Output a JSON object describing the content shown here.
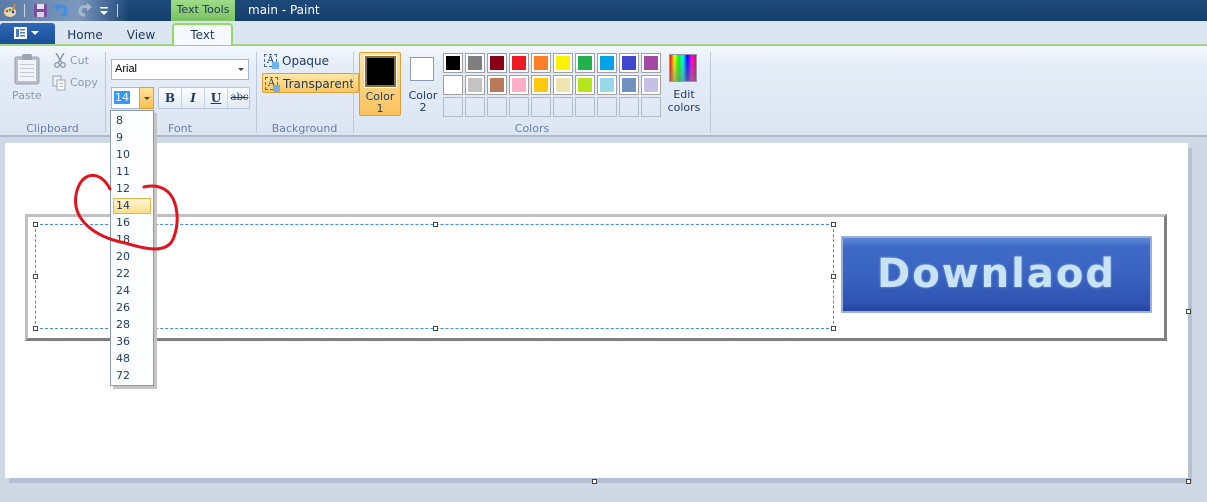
{
  "titlebar": {
    "context_tab": "Text Tools",
    "window_title": "main - Paint"
  },
  "tabs": [
    {
      "label": "Home",
      "active": false
    },
    {
      "label": "View",
      "active": false
    },
    {
      "label": "Text",
      "active": true
    }
  ],
  "ribbon": {
    "clipboard": {
      "group_label": "Clipboard",
      "paste_label": "Paste",
      "cut_label": "Cut",
      "copy_label": "Copy"
    },
    "font": {
      "group_label": "Font",
      "font_name": "Arial",
      "font_size": "14",
      "bold_label": "B",
      "italic_label": "I",
      "underline_label": "U",
      "strike_label": "abc"
    },
    "background": {
      "group_label": "Background",
      "opaque_label": "Opaque",
      "transparent_label": "Transparent",
      "selected": "Transparent"
    },
    "colors": {
      "group_label": "Colors",
      "color1_line1": "Color",
      "color1_line2": "1",
      "color2_line1": "Color",
      "color2_line2": "2",
      "color1_value": "#000000",
      "color2_value": "#ffffff",
      "edit_line1": "Edit",
      "edit_line2": "colors",
      "palette_row1": [
        "#000000",
        "#7f7f7f",
        "#880015",
        "#ed1c24",
        "#ff7f27",
        "#fff200",
        "#22b14c",
        "#00a2e8",
        "#3f48cc",
        "#a349a4"
      ],
      "palette_row2": [
        "#ffffff",
        "#c3c3c3",
        "#b97a57",
        "#ffaec9",
        "#ffc90e",
        "#efe4b0",
        "#b5e61d",
        "#99d9ea",
        "#7092be",
        "#c8bfe7"
      ],
      "custom_slots": 10
    }
  },
  "font_size_dropdown": {
    "options": [
      "8",
      "9",
      "10",
      "11",
      "12",
      "14",
      "16",
      "18",
      "20",
      "22",
      "24",
      "26",
      "28",
      "36",
      "48",
      "72"
    ],
    "selected": "14"
  },
  "canvas": {
    "button_image_text": "Downlaod"
  },
  "annotation": {
    "color": "#e0141e",
    "description": "red hand-drawn circle around font sizes 11-18"
  }
}
